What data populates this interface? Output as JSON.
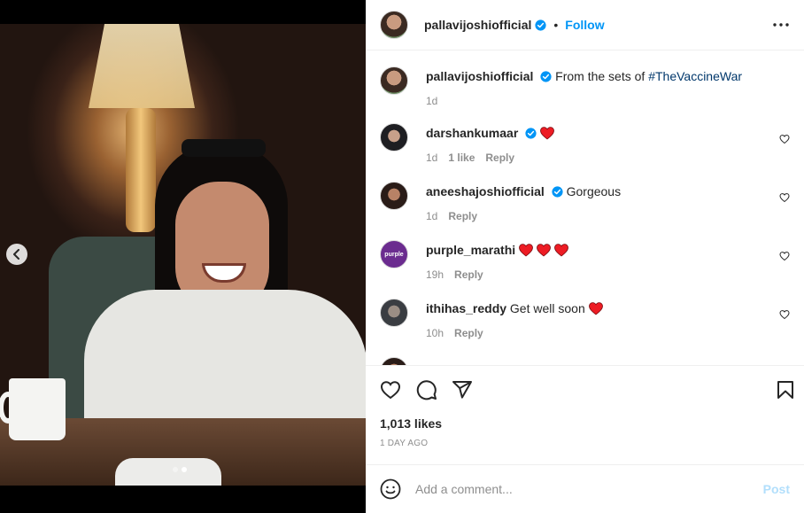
{
  "post": {
    "username": "pallavijoshiofficial",
    "separator": "•",
    "follow_label": "Follow",
    "caption_text": "From the sets of ",
    "caption_hashtag": "#TheVaccineWar",
    "caption_time": "1d",
    "likes": "1,013 likes",
    "date": "1 DAY AGO"
  },
  "carousel": {
    "slide_count": 2,
    "active_slide": 2
  },
  "comments": [
    {
      "username": "darshankumaar",
      "text": "",
      "emoji": [
        "red-heart"
      ],
      "time": "1d",
      "likes": "1 like",
      "reply": "Reply"
    },
    {
      "username": "aneeshajoshiofficial",
      "text": "Gorgeous",
      "emoji": [],
      "time": "1d",
      "likes": "",
      "reply": "Reply"
    },
    {
      "username": "purple_marathi",
      "text": "",
      "emoji": [
        "red-heart",
        "red-heart",
        "red-heart"
      ],
      "time": "19h",
      "likes": "",
      "reply": "Reply"
    },
    {
      "username": "ithihas_reddy",
      "text": "Get well soon",
      "emoji": [
        "red-heart"
      ],
      "time": "10h",
      "likes": "",
      "reply": "Reply"
    }
  ],
  "avatar_text": {
    "purple_marathi": "purple"
  },
  "add_comment": {
    "placeholder": "Add a comment...",
    "post_label": "Post"
  },
  "colors": {
    "accent": "#0095f6",
    "hashtag": "#00376b",
    "heart": "#ed1c24",
    "post_disabled": "#b2dffc",
    "verified": "#0095f6"
  },
  "icons": [
    "chevron-left-icon",
    "more-icon",
    "verified-icon",
    "heart-icon",
    "comment-icon",
    "share-icon",
    "bookmark-icon",
    "emoji-icon"
  ]
}
